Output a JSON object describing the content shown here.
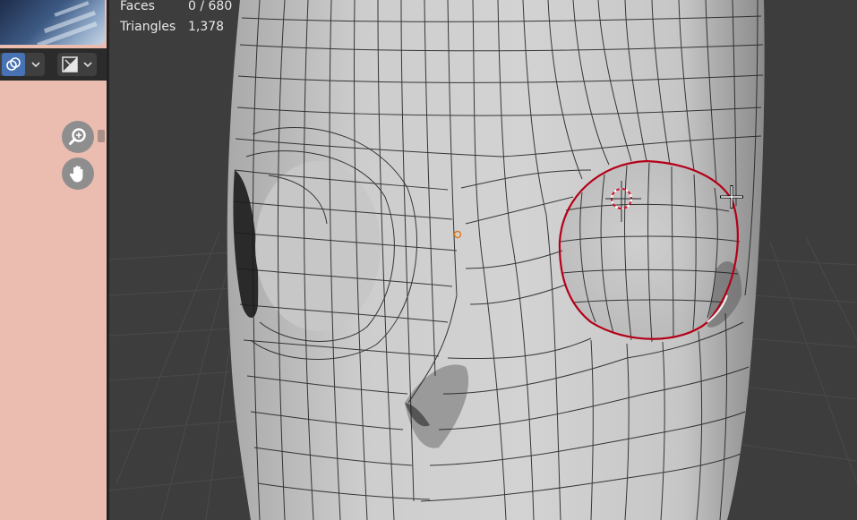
{
  "stats": {
    "faces_label": "Faces",
    "faces_value": "0 / 680",
    "triangles_label": "Triangles",
    "triangles_value": "1,378"
  },
  "toolbar": {
    "viewport_shading_icon": "overlay-circles-icon",
    "shading_dropdown_icon": "chevron-down-icon",
    "xray_icon": "xray-toggle-icon",
    "xray_dropdown_icon": "chevron-down-icon"
  },
  "navigation": {
    "zoom_icon": "zoom-magnifier-icon",
    "pan_icon": "hand-pan-icon"
  },
  "colors": {
    "side_panel": "#ebbcb0",
    "viewport_bg": "#3d3d3d",
    "mesh_surface": "#c4c4c4",
    "selected_edge": "#c00018",
    "wire": "#1a1a1a"
  }
}
